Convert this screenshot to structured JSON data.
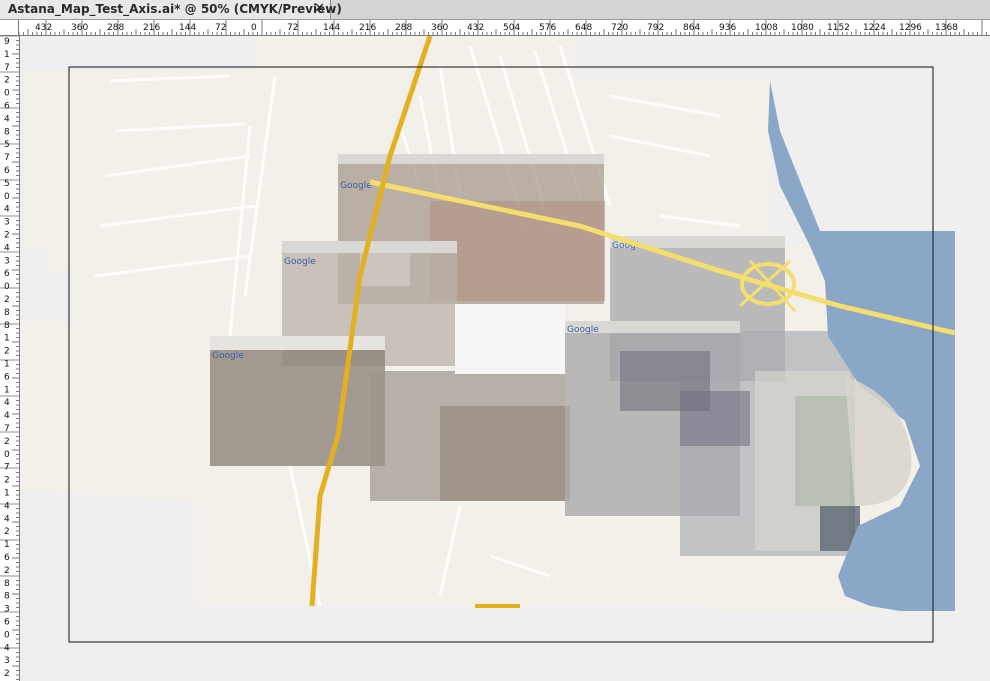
{
  "document": {
    "tab_title": "Astana_Map_Test_Axis.ai* @ 50% (CMYK/Preview)",
    "close_glyph": "✕"
  },
  "rulers": {
    "horizontal_labels": [
      "432",
      "360",
      "288",
      "216",
      "144",
      "72",
      "0",
      "72",
      "144",
      "216",
      "288",
      "360",
      "432",
      "504",
      "576",
      "648",
      "720",
      "792",
      "864",
      "936",
      "1008",
      "1080",
      "1152",
      "1224",
      "1296",
      "1368"
    ],
    "vertical_labels": [
      "9",
      "1",
      "7",
      "2",
      "0",
      "6",
      "4",
      "8",
      "5",
      "7",
      "6",
      "5",
      "0",
      "4",
      "3",
      "2",
      "4",
      "3",
      "6",
      "0",
      "2",
      "8",
      "8",
      "1",
      "2",
      "1",
      "6",
      "1",
      "4",
      "4",
      "7",
      "2",
      "0",
      "7",
      "2",
      "1",
      "4",
      "4",
      "2",
      "1",
      "6",
      "2",
      "8",
      "8",
      "3",
      "6",
      "0",
      "4",
      "3",
      "2"
    ]
  },
  "artwork": {
    "river_color": "#8ba7c8",
    "road_color": "#e2b020",
    "highway_color": "#f3de6e",
    "map_bg_color": "#f3efe9",
    "map_thumb_label": "Google"
  }
}
